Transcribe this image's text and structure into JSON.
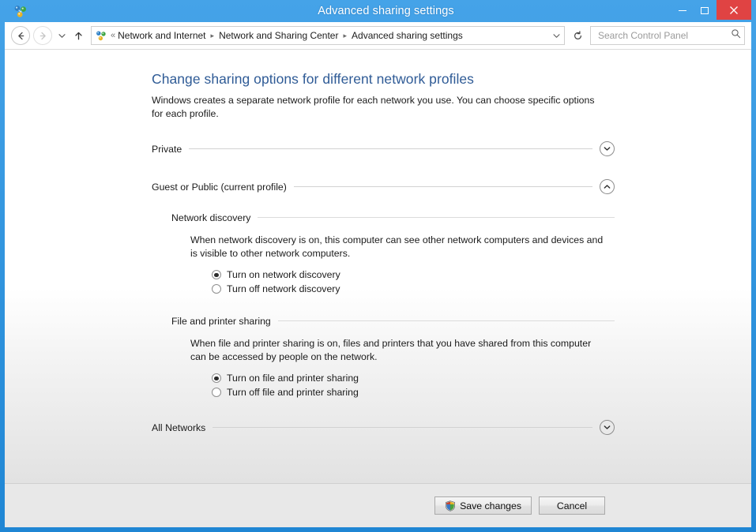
{
  "window": {
    "title": "Advanced sharing settings",
    "app_icon": "network-sharing-icon",
    "minimize_label": "Minimize",
    "maximize_label": "Maximize",
    "close_label": "Close"
  },
  "toolbar": {
    "back_label": "Back",
    "forward_label": "Forward",
    "recent_label": "Recent locations",
    "up_label": "Up one level",
    "refresh_label": "Refresh",
    "breadcrumb_overflow": "«",
    "breadcrumb": [
      "Network and Internet",
      "Network and Sharing Center",
      "Advanced sharing settings"
    ],
    "search": {
      "placeholder": "Search Control Panel",
      "value": ""
    }
  },
  "main": {
    "heading": "Change sharing options for different network profiles",
    "description": "Windows creates a separate network profile for each network you use. You can choose specific options for each profile.",
    "profiles": [
      {
        "label": "Private",
        "expanded": false,
        "chevron": "chevron-down-icon"
      },
      {
        "label": "Guest or Public (current profile)",
        "expanded": true,
        "chevron": "chevron-up-icon",
        "sections": [
          {
            "title": "Network discovery",
            "description": "When network discovery is on, this computer can see other network computers and devices and is visible to other network computers.",
            "options": [
              {
                "label": "Turn on network discovery",
                "checked": true
              },
              {
                "label": "Turn off network discovery",
                "checked": false
              }
            ]
          },
          {
            "title": "File and printer sharing",
            "description": "When file and printer sharing is on, files and printers that you have shared from this computer can be accessed by people on the network.",
            "options": [
              {
                "label": "Turn on file and printer sharing",
                "checked": true
              },
              {
                "label": "Turn off file and printer sharing",
                "checked": false
              }
            ]
          }
        ]
      },
      {
        "label": "All Networks",
        "expanded": false,
        "chevron": "chevron-down-icon"
      }
    ]
  },
  "footer": {
    "save_label": "Save changes",
    "save_icon": "uac-shield-icon",
    "cancel_label": "Cancel"
  },
  "colors": {
    "titlebar_blue": "#2f93dd",
    "close_red": "#e04343",
    "heading_blue": "#2f5b96",
    "footer_gray": "#e8e8e8"
  }
}
